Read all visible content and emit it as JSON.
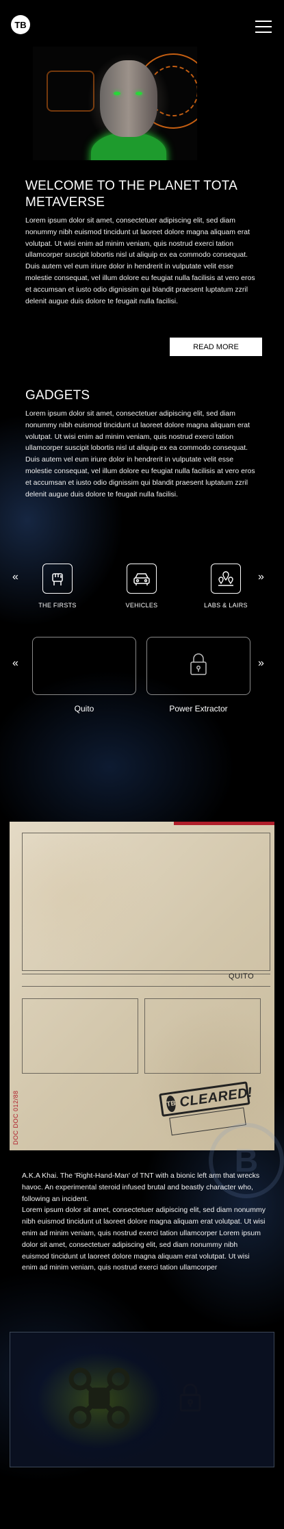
{
  "header": {
    "logo_text": "TB",
    "logo_icon": "tb-logo-icon",
    "menu_icon": "hamburger-menu-icon"
  },
  "hero": {
    "title_line1": "WELCOME TO THE PLANET TOTA",
    "title_line2": "METAVERSE",
    "body": "Lorem ipsum dolor sit amet, consectetuer adipiscing elit, sed diam nonummy nibh euismod tincidunt ut laoreet dolore magna aliquam erat volutpat. Ut wisi enim ad minim veniam, quis nostrud exerci tation ullamcorper suscipit lobortis nisl ut aliquip ex ea commodo consequat. Duis autem vel eum iriure dolor in hendrerit in vulputate velit esse molestie consequat, vel illum dolore eu feugiat nulla facilisis at vero eros et accumsan et iusto odio dignissim qui blandit praesent luptatum zzril delenit augue duis dolore te feugait nulla facilisi.",
    "read_more_label": "READ MORE",
    "accent_color": "#27d838"
  },
  "gadgets": {
    "title": "GADGETS",
    "body": "Lorem ipsum dolor sit amet, consectetuer adipiscing elit, sed diam nonummy nibh euismod tincidunt ut laoreet dolore magna aliquam erat volutpat. Ut wisi enim ad minim veniam, quis nostrud exerci tation ullamcorper suscipit lobortis nisl ut aliquip ex ea commodo consequat. Duis autem vel eum iriure dolor in hendrerit in vulputate velit esse molestie consequat, vel illum dolore eu feugiat nulla facilisis at vero eros et accumsan et iusto odio dignissim qui blandit praesent luptatum zzril delenit augue duis dolore te feugait nulla facilisi.",
    "prev_arrow": "«",
    "next_arrow": "»",
    "categories": [
      {
        "label": "THE FIRSTS",
        "icon": "fist-icon"
      },
      {
        "label": "VEHICLES",
        "icon": "vehicle-icon"
      },
      {
        "label": "LABS & LAIRS",
        "icon": "map-pins-icon"
      }
    ],
    "items": [
      {
        "label": "Quito",
        "locked": false
      },
      {
        "label": "Power Extractor",
        "locked": true,
        "icon": "lock-icon"
      }
    ]
  },
  "dossier": {
    "name_tag": "QUITO",
    "side_code": "DOC DOC 012/88",
    "stamp_word": "CLEARED!",
    "stamp_seal": "TB",
    "stamp_color": "#222222",
    "side_code_color": "#b01e2a"
  },
  "profile": {
    "body": "A.K.A Khai. The 'Right-Hand-Man' of TNT with a bionic left arm that wrecks havoc. An experimental steroid infused brutal and beastly character who, following an incident.\nLorem ipsum dolor sit amet, consectetuer adipiscing elit, sed diam nonummy nibh euismod tincidunt ut laoreet dolore magna aliquam erat volutpat. Ut wisi enim ad minim veniam, quis nostrud exerci tation ullamcorper Lorem ipsum dolor sit amet, consectetuer adipiscing elit, sed diam nonummy nibh euismod tincidunt ut laoreet dolore magna aliquam erat volutpat. Ut wisi enim ad minim veniam, quis nostrud exerci tation ullamcorper",
    "watermark_text": "B"
  },
  "drone_panel": {
    "drone_icon": "drone-icon",
    "lock_icon": "lock-icon"
  }
}
